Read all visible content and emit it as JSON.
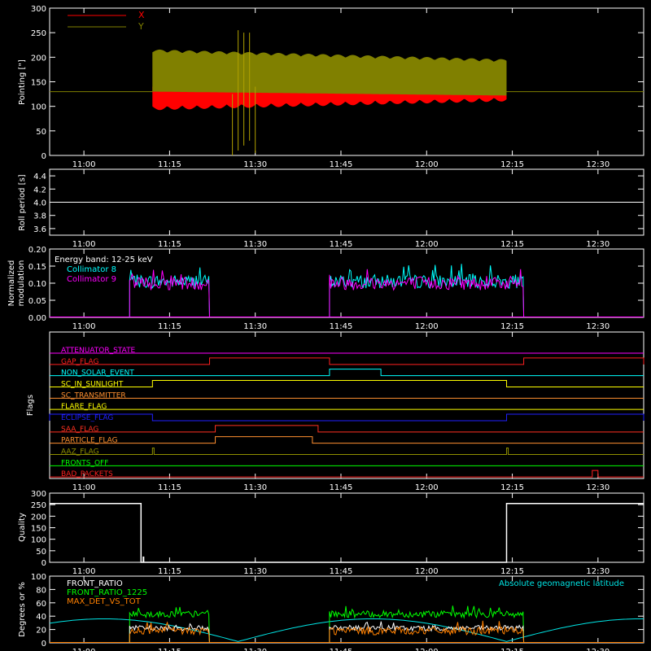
{
  "chart_data": [
    {
      "id": "pointing",
      "type": "line",
      "ylabel": "Pointing [\"]",
      "ylim": [
        0,
        300
      ],
      "yticks": [
        0,
        50,
        100,
        150,
        200,
        250,
        300
      ],
      "xlim": [
        "10:54",
        "12:38"
      ],
      "xticks": [
        "11:00",
        "11:15",
        "11:30",
        "11:45",
        "12:00",
        "12:15",
        "12:30"
      ],
      "legend_position": "top-left",
      "series": [
        {
          "name": "X",
          "color": "#ff0000",
          "band": {
            "x_start": "11:12",
            "x_end": "12:14",
            "low_start": 100,
            "low_end": 118,
            "high_start": 140,
            "high_end": 125
          }
        },
        {
          "name": "Y",
          "color": "#808000",
          "baseline": 130,
          "band": {
            "x_start": "11:12",
            "x_end": "12:14",
            "low_start": 130,
            "low_end": 122,
            "high_start": 210,
            "high_end": 190
          }
        }
      ],
      "spikes": [
        {
          "x": "11:26",
          "low": 0,
          "high": 125
        },
        {
          "x": "11:27",
          "low": 10,
          "high": 255
        },
        {
          "x": "11:28",
          "low": 20,
          "high": 250
        },
        {
          "x": "11:29",
          "low": 30,
          "high": 250
        },
        {
          "x": "11:30",
          "low": 5,
          "high": 140
        }
      ]
    },
    {
      "id": "roll",
      "type": "line",
      "ylabel": "Roll period [s]",
      "ylim": [
        3.5,
        4.5
      ],
      "yticks": [
        "3.6",
        "3.8",
        "4.0",
        "4.2",
        "4.4"
      ],
      "xlim": [
        "10:54",
        "12:38"
      ],
      "xticks": [
        "11:00",
        "11:15",
        "11:30",
        "11:45",
        "12:00",
        "12:15",
        "12:30"
      ],
      "series": [
        {
          "name": "",
          "color": "#ffffff",
          "constant": 4.0
        }
      ]
    },
    {
      "id": "modulation",
      "type": "line",
      "ylabel": "Normalized modulation",
      "ylim": [
        0,
        0.2
      ],
      "yticks": [
        "0.00",
        "0.05",
        "0.10",
        "0.15",
        "0.20"
      ],
      "xlim": [
        "10:54",
        "12:38"
      ],
      "xticks": [
        "11:00",
        "11:15",
        "11:30",
        "11:45",
        "12:00",
        "12:15",
        "12:30"
      ],
      "annotation": "Energy band: 12-25 keV",
      "intervals": [
        {
          "start": "11:08",
          "end": "11:22"
        },
        {
          "start": "11:43",
          "end": "12:17"
        }
      ],
      "series": [
        {
          "name": "Collimator 8",
          "color": "#00ffff",
          "mean": 0.105,
          "spread": 0.02
        },
        {
          "name": "Collimator 9",
          "color": "#ff00ff",
          "mean": 0.1,
          "spread": 0.02
        }
      ]
    },
    {
      "id": "flags",
      "type": "line",
      "ylabel": "Flags",
      "xlim": [
        "10:54",
        "12:38"
      ],
      "xticks": [
        "11:00",
        "11:15",
        "11:30",
        "11:45",
        "12:00",
        "12:15",
        "12:30"
      ],
      "flags": [
        {
          "name": "ATTENUATOR_STATE",
          "color": "#ff00ff",
          "on": []
        },
        {
          "name": "GAP_FLAG",
          "color": "#ff2020",
          "on": [
            [
              "11:22",
              "11:43"
            ],
            [
              "12:17",
              "12:38"
            ]
          ]
        },
        {
          "name": "NON_SOLAR_EVENT",
          "color": "#00ffff",
          "on": [
            [
              "11:43",
              "11:52"
            ]
          ]
        },
        {
          "name": "SC_IN_SUNLIGHT",
          "color": "#ffff00",
          "on": [
            [
              "11:12",
              "12:14"
            ]
          ]
        },
        {
          "name": "SC_TRANSMITTER",
          "color": "#ff9030",
          "on": []
        },
        {
          "name": "FLARE_FLAG",
          "color": "#ffff00",
          "on": []
        },
        {
          "name": "ECLIPSE_FLAG",
          "color": "#2020ff",
          "on": [
            [
              "10:54",
              "11:12"
            ],
            [
              "12:14",
              "12:38"
            ]
          ]
        },
        {
          "name": "SAA_FLAG",
          "color": "#ff3020",
          "on": [
            [
              "11:23",
              "11:41"
            ]
          ]
        },
        {
          "name": "PARTICLE_FLAG",
          "color": "#ff9030",
          "on": [
            [
              "11:23",
              "11:40"
            ]
          ]
        },
        {
          "name": "AAZ_FLAG",
          "color": "#909000",
          "on": [
            [
              "11:12",
              "11:12"
            ],
            [
              "12:14",
              "12:14"
            ]
          ]
        },
        {
          "name": "FRONTS_OFF",
          "color": "#00ff00",
          "on": []
        },
        {
          "name": "BAD_PACKETS",
          "color": "#ff2020",
          "on": [
            [
              "12:29",
              "12:30"
            ]
          ]
        }
      ]
    },
    {
      "id": "quality",
      "type": "line",
      "ylabel": "Quality",
      "ylim": [
        0,
        300
      ],
      "yticks": [
        0,
        50,
        100,
        150,
        200,
        250,
        300
      ],
      "xlim": [
        "10:54",
        "12:38"
      ],
      "xticks": [
        "11:00",
        "11:15",
        "11:30",
        "11:45",
        "12:00",
        "12:15",
        "12:30"
      ],
      "series": [
        {
          "name": "",
          "color": "#ffffff",
          "points": [
            [
              "10:54",
              255
            ],
            [
              "11:10",
              255
            ],
            [
              "11:10",
              0
            ],
            [
              "12:14",
              0
            ],
            [
              "12:14",
              255
            ],
            [
              "12:38",
              255
            ]
          ]
        }
      ]
    },
    {
      "id": "ratios",
      "type": "line",
      "ylabel": "Degrees or %",
      "ylim": [
        0,
        100
      ],
      "yticks": [
        0,
        20,
        40,
        60,
        80,
        100
      ],
      "xlim": [
        "10:54",
        "12:38"
      ],
      "xticks": [
        "11:00",
        "11:15",
        "11:30",
        "11:45",
        "12:00",
        "12:15",
        "12:30"
      ],
      "legend_position": "top-left",
      "intervals": [
        {
          "start": "11:08",
          "end": "11:22"
        },
        {
          "start": "11:43",
          "end": "12:17"
        }
      ],
      "series": [
        {
          "name": "FRONT_RATIO",
          "color": "#ffffff",
          "mean": 22,
          "spread": 4
        },
        {
          "name": "FRONT_RATIO_1225",
          "color": "#00ff00",
          "mean": 43,
          "spread": 5
        },
        {
          "name": "MAX_DET_VS_TOT",
          "color": "#ff8000",
          "mean": 18,
          "spread": 6
        }
      ],
      "overlay": {
        "name": "Absolute geomagnetic latitude",
        "color": "#00e5e5"
      }
    }
  ]
}
